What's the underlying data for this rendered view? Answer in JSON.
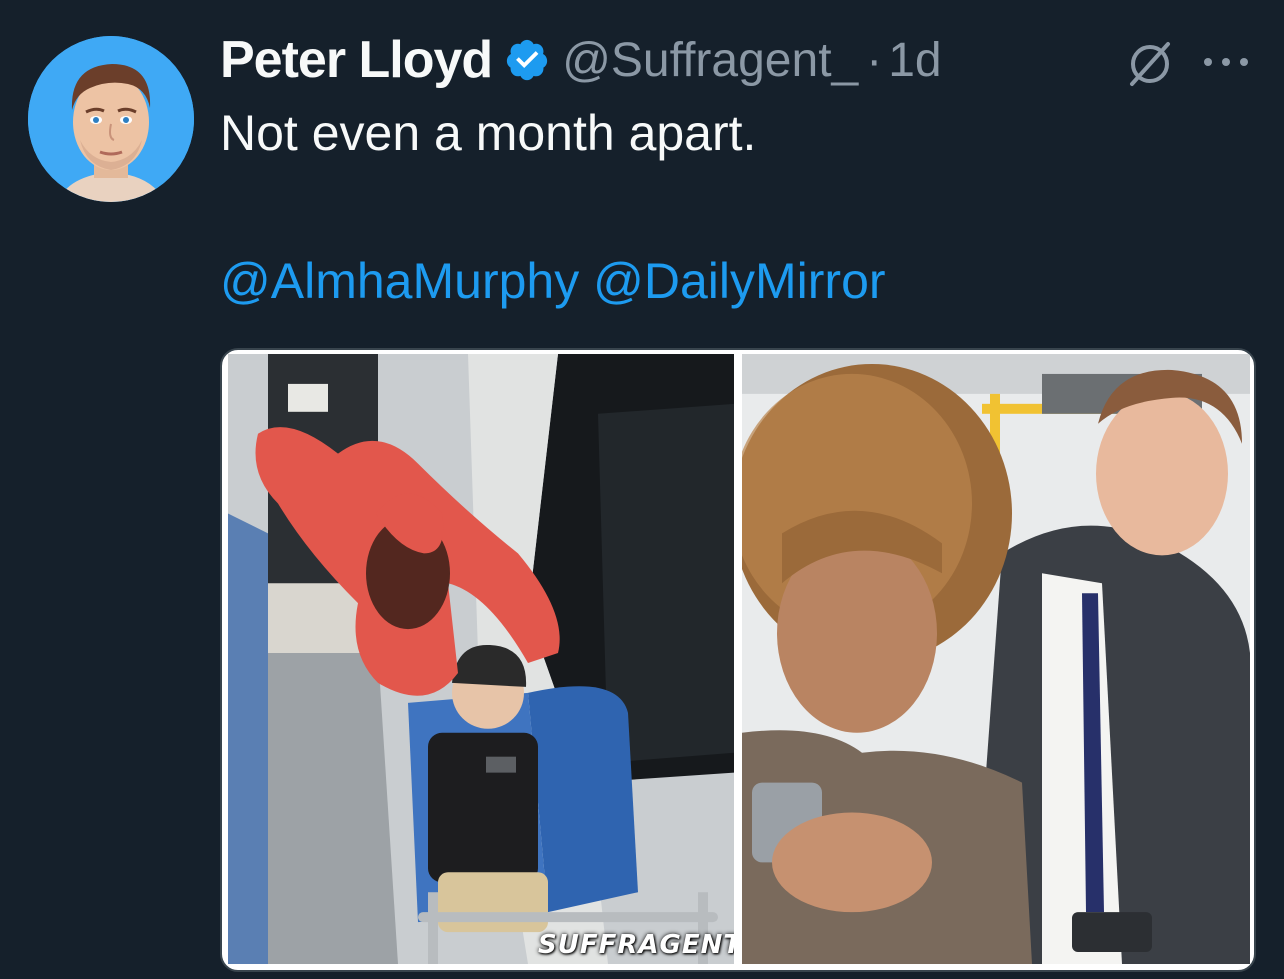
{
  "tweet": {
    "author_name": "Peter Lloyd",
    "handle": "@Suffragent_",
    "separator": "·",
    "time": "1d",
    "text": "Not even a month apart.",
    "mentions": [
      "@AlmhaMurphy",
      "@DailyMirror"
    ],
    "media": {
      "watermark": "SUFFRAGENT"
    }
  },
  "icons": {
    "verified": "verified-badge-icon",
    "grok": "grok-icon",
    "more": "more-icon"
  },
  "colors": {
    "background": "#15202b",
    "text_primary": "#f7f9f9",
    "text_secondary": "#8b98a5",
    "link": "#1d9bf0",
    "verified": "#1d9bf0"
  }
}
